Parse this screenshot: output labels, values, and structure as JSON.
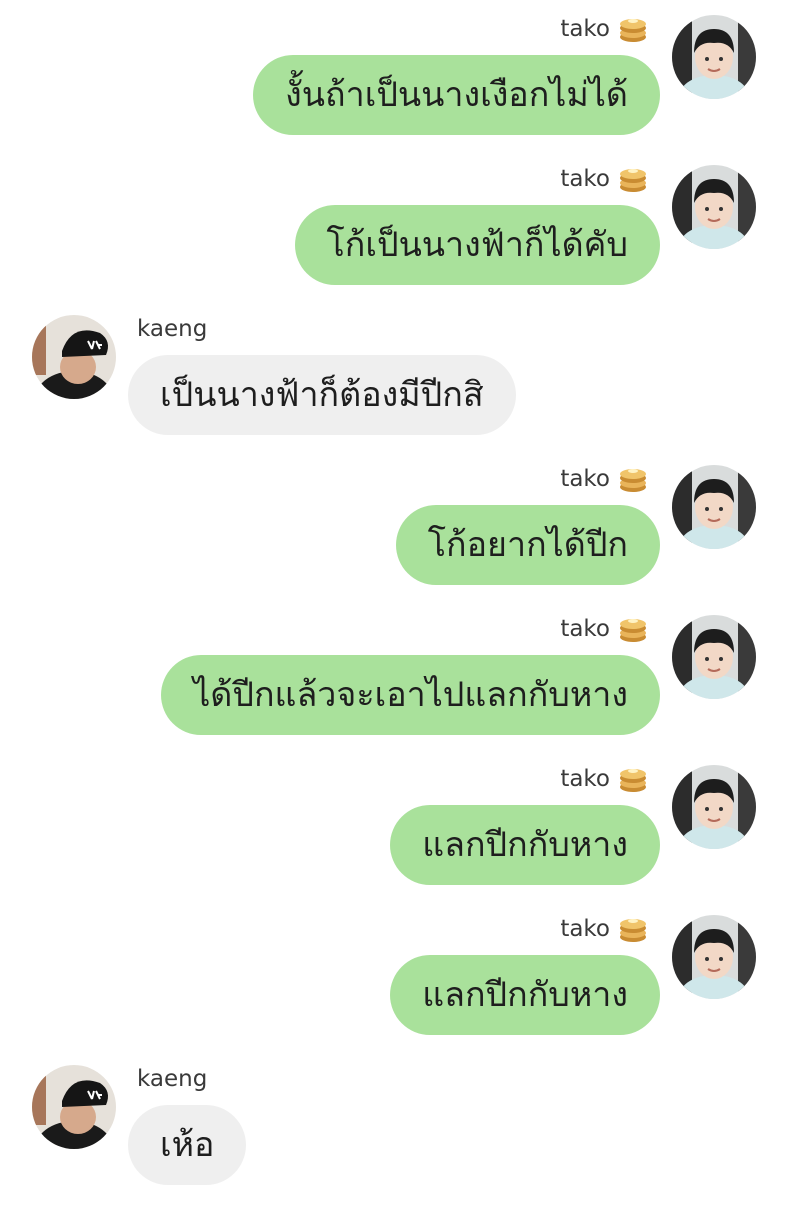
{
  "chat": {
    "messages": [
      {
        "sender": "tako",
        "text": "งั้นถ้าเป็นนางเงือกไม่ได้",
        "direction": "out"
      },
      {
        "sender": "tako",
        "text": "โก้เป็นนางฟ้าก็ได้คับ",
        "direction": "out"
      },
      {
        "sender": "kaeng",
        "text": "เป็นนางฟ้าก็ต้องมีปีกสิ",
        "direction": "in"
      },
      {
        "sender": "tako",
        "text": "โก้อยากได้ปีก",
        "direction": "out"
      },
      {
        "sender": "tako",
        "text": "ได้ปีกแล้วจะเอาไปแลกกับหาง",
        "direction": "out"
      },
      {
        "sender": "tako",
        "text": "แลกปีกกับหาง",
        "direction": "out"
      },
      {
        "sender": "tako",
        "text": "แลกปีกกับหาง",
        "direction": "out"
      },
      {
        "sender": "kaeng",
        "text": "เห้อ",
        "direction": "in"
      }
    ]
  },
  "colors": {
    "outgoing_bubble": "#a9e19b",
    "incoming_bubble": "#efefef",
    "background": "#ffffff"
  },
  "icons": {
    "tako_name_suffix": "pancake-icon",
    "tako_avatar": "child-avatar",
    "kaeng_avatar": "cap-avatar"
  }
}
